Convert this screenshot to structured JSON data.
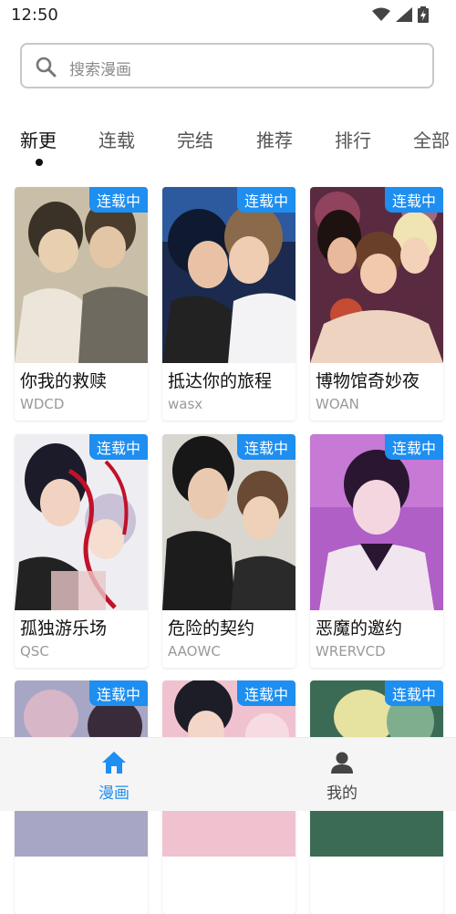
{
  "status": {
    "time": "12:50",
    "icons": [
      "wifi-icon",
      "signal-icon",
      "battery-icon"
    ]
  },
  "search": {
    "placeholder": "搜索漫画",
    "icon": "search-icon"
  },
  "tabs": [
    {
      "label": "新更",
      "active": true
    },
    {
      "label": "连载"
    },
    {
      "label": "完结"
    },
    {
      "label": "推荐"
    },
    {
      "label": "排行"
    },
    {
      "label": "全部"
    }
  ],
  "comics": [
    {
      "title": "你我的救赎",
      "author": "WDCD",
      "badge": "连载中"
    },
    {
      "title": "抵达你的旅程",
      "author": "wasx",
      "badge": "连载中"
    },
    {
      "title": "博物馆奇妙夜",
      "author": "WOAN",
      "badge": "连载中"
    },
    {
      "title": "孤独游乐场",
      "author": "QSC",
      "badge": "连载中"
    },
    {
      "title": "危险的契约",
      "author": "AAOWC",
      "badge": "连载中"
    },
    {
      "title": "恶魔的邀约",
      "author": "WRERVCD",
      "badge": "连载中"
    },
    {
      "badge": "连载中"
    },
    {
      "badge": "连载中"
    },
    {
      "badge": "连载中"
    }
  ],
  "nav": [
    {
      "label": "漫画",
      "icon": "home-icon",
      "active": true,
      "color": "#1e8ef0"
    },
    {
      "label": "我的",
      "icon": "person-icon",
      "active": false,
      "color": "#444444"
    }
  ],
  "colors": {
    "accent": "#1e8ef0",
    "text": "#111111",
    "muted": "#9a9a9a"
  }
}
